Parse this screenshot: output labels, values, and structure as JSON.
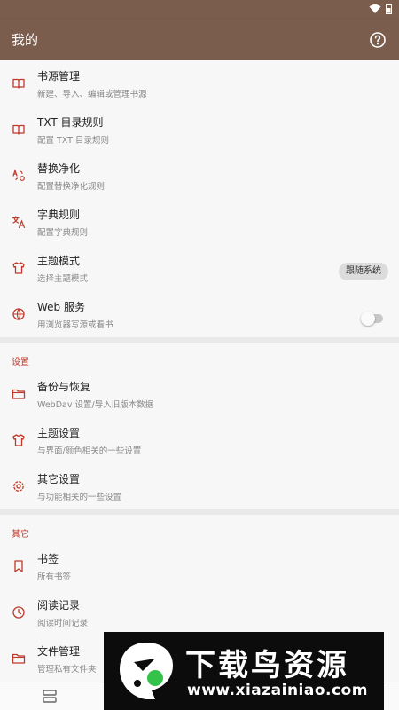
{
  "app": {
    "title": "我的"
  },
  "colors": {
    "primary": "#7b5d4e",
    "accent": "#c0392b"
  },
  "main_group": {
    "items": [
      {
        "title": "书源管理",
        "subtitle": "新建、导入、编辑或管理书源",
        "icon": "book-open-icon"
      },
      {
        "title": "TXT 目录规则",
        "subtitle": "配置 TXT 目录规则",
        "icon": "book-open-icon"
      },
      {
        "title": "替换净化",
        "subtitle": "配置替换净化规则",
        "icon": "replace-icon"
      },
      {
        "title": "字典规则",
        "subtitle": "配置字典规则",
        "icon": "translate-icon"
      },
      {
        "title": "主题模式",
        "subtitle": "选择主题模式",
        "icon": "shirt-icon",
        "value": "跟随系统"
      },
      {
        "title": "Web 服务",
        "subtitle": "用浏览器写源或看书",
        "icon": "globe-icon",
        "switch_on": false
      }
    ]
  },
  "settings": {
    "header": "设置",
    "items": [
      {
        "title": "备份与恢复",
        "subtitle": "WebDav 设置/导入旧版本数据",
        "icon": "folder-icon"
      },
      {
        "title": "主题设置",
        "subtitle": "与界面/颜色相关的一些设置",
        "icon": "shirt-icon"
      },
      {
        "title": "其它设置",
        "subtitle": "与功能相关的一些设置",
        "icon": "gear-icon"
      }
    ]
  },
  "other": {
    "header": "其它",
    "items": [
      {
        "title": "书签",
        "subtitle": "所有书签",
        "icon": "bookmark-icon"
      },
      {
        "title": "阅读记录",
        "subtitle": "阅读时间记录",
        "icon": "clock-icon"
      },
      {
        "title": "文件管理",
        "subtitle": "管理私有文件夹",
        "icon": "folder-icon"
      }
    ]
  },
  "watermark": {
    "title": "下载鸟资源",
    "url": "www.xiazainiao.com"
  }
}
